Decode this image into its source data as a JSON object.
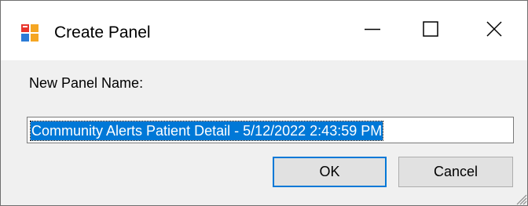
{
  "window": {
    "title": "Create Panel",
    "icon": "application-window-icon",
    "controls": {
      "minimize_icon": "minimize-icon",
      "maximize_icon": "maximize-icon",
      "close_icon": "close-icon"
    }
  },
  "form": {
    "label": "New Panel Name:",
    "panel_name_value": "Community Alerts Patient Detail - 5/12/2022 2:43:59 PM",
    "text_selected": true
  },
  "buttons": {
    "ok_label": "OK",
    "cancel_label": "Cancel"
  },
  "colors": {
    "selection": "#0078d7",
    "default_button_border": "#0078d7",
    "dialog_background": "#f0f0f0",
    "titlebar_background": "#ffffff"
  }
}
